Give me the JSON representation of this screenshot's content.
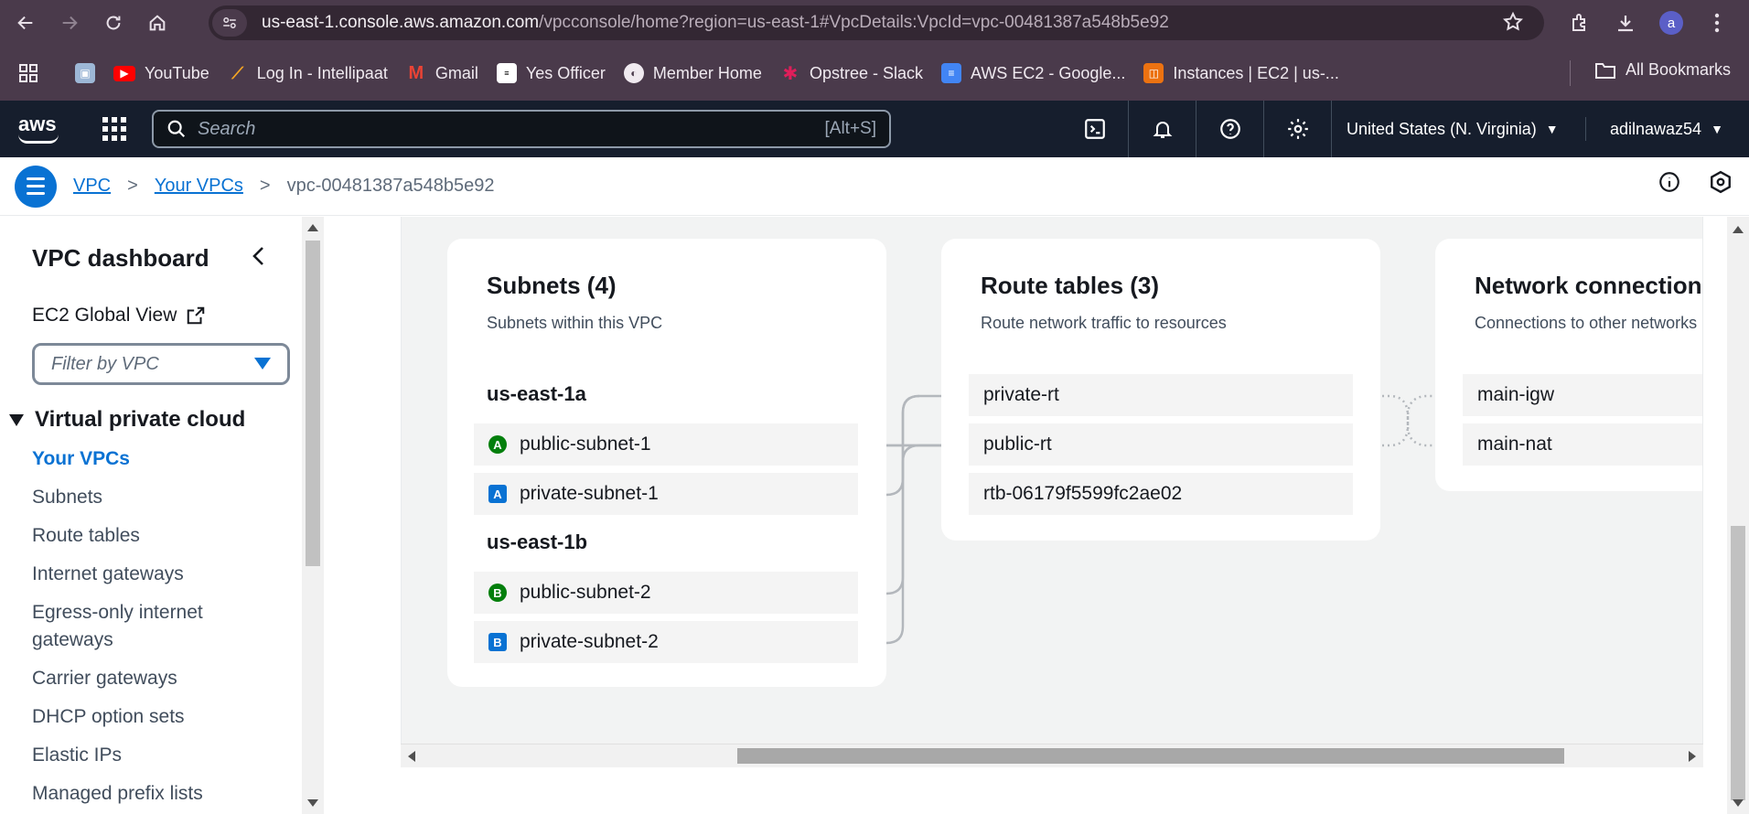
{
  "browser": {
    "url_host": "us-east-1.console.aws.amazon.com",
    "url_path": "/vpcconsole/home?region=us-east-1#VpcDetails:VpcId=vpc-00481387a548b5e92",
    "profile_initial": "a"
  },
  "bookmarks": {
    "items": [
      {
        "label": "YouTube"
      },
      {
        "label": "Log In - Intellipaat"
      },
      {
        "label": "Gmail"
      },
      {
        "label": "Yes Officer"
      },
      {
        "label": "Member Home"
      },
      {
        "label": "Opstree - Slack"
      },
      {
        "label": "AWS EC2 - Google..."
      },
      {
        "label": "Instances | EC2 | us-..."
      }
    ],
    "all_label": "All Bookmarks"
  },
  "aws_header": {
    "logo_text": "aws",
    "search_placeholder": "Search",
    "search_shortcut": "[Alt+S]",
    "region": "United States (N. Virginia)",
    "account": "adilnawaz54"
  },
  "breadcrumb": {
    "items": [
      "VPC",
      "Your VPCs"
    ],
    "current": "vpc-00481387a548b5e92"
  },
  "sidebar": {
    "title": "VPC dashboard",
    "global_view": "EC2 Global View",
    "filter_placeholder": "Filter by VPC",
    "section": "Virtual private cloud",
    "items": [
      {
        "label": "Your VPCs"
      },
      {
        "label": "Subnets"
      },
      {
        "label": "Route tables"
      },
      {
        "label": "Internet gateways"
      },
      {
        "label": "Egress-only internet gateways"
      },
      {
        "label": "Carrier gateways"
      },
      {
        "label": "DHCP option sets"
      },
      {
        "label": "Elastic IPs"
      },
      {
        "label": "Managed prefix lists"
      }
    ]
  },
  "resource_map": {
    "subnets": {
      "title": "Subnets (4)",
      "subtitle": "Subnets within this VPC",
      "az1": "us-east-1a",
      "az2": "us-east-1b",
      "rows": [
        {
          "badge": "A",
          "name": "public-subnet-1"
        },
        {
          "badge": "A",
          "name": "private-subnet-1"
        },
        {
          "badge": "B",
          "name": "public-subnet-2"
        },
        {
          "badge": "B",
          "name": "private-subnet-2"
        }
      ]
    },
    "route_tables": {
      "title": "Route tables (3)",
      "subtitle": "Route network traffic to resources",
      "rows": [
        "private-rt",
        "public-rt",
        "rtb-06179f5599fc2ae02"
      ]
    },
    "network_connections": {
      "title": "Network connection",
      "subtitle": "Connections to other networks",
      "rows": [
        "main-igw",
        "main-nat"
      ]
    }
  },
  "colors": {
    "public_badge": "#037f0c",
    "private_badge": "#0972d3",
    "link": "#0972d3"
  }
}
